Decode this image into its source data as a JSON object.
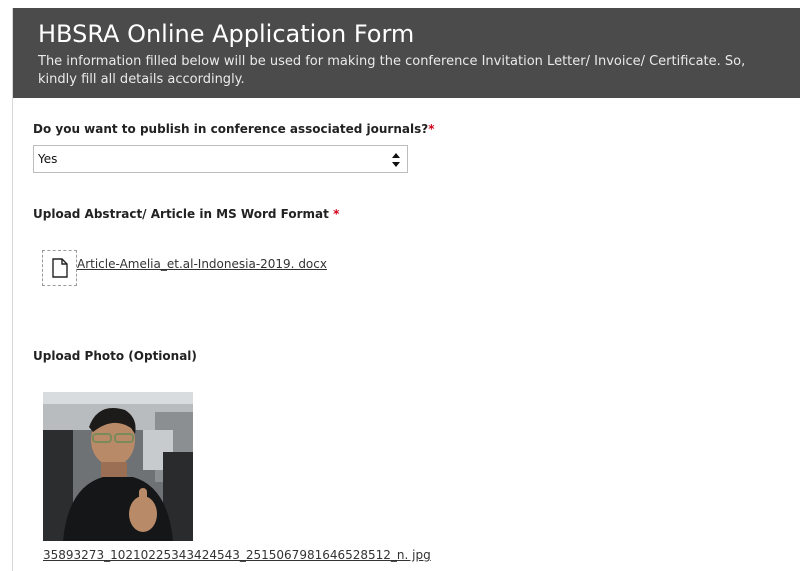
{
  "form": {
    "title": "HBSRA Online Application Form",
    "subtitle": "The information filled below will be used for making the conference Invitation Letter/ Invoice/ Certificate. So, kindly fill all details accordingly."
  },
  "publish_question": {
    "label": "Do you want to publish in conference associated journals?",
    "required_mark": "*",
    "selected_value": "Yes"
  },
  "upload_abstract": {
    "label": "Upload Abstract/ Article in MS Word Format",
    "required_mark": "*",
    "file_icon": "document-icon",
    "file_name": "Article-Amelia_et.al-Indonesia-2019. docx"
  },
  "upload_photo": {
    "label": "Upload Photo (Optional)",
    "file_name": "35893273_10210225343424543_2515067981646528512_n. jpg"
  },
  "colors": {
    "header_bg": "#4b4b4b",
    "required": "#d0021b"
  }
}
